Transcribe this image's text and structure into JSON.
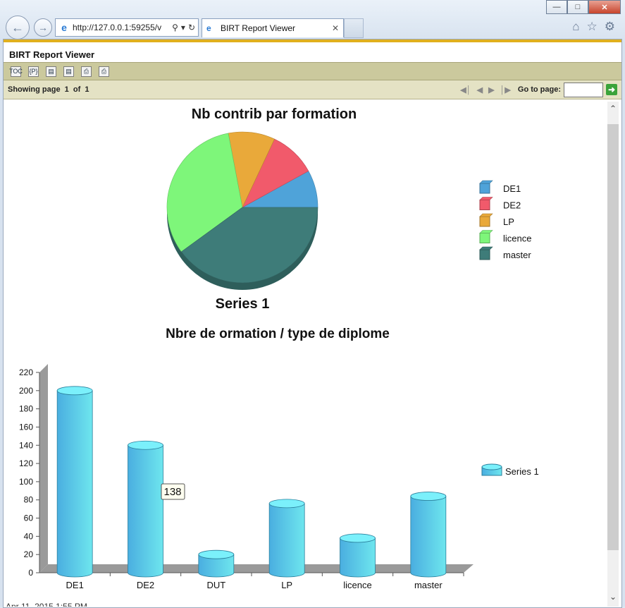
{
  "browser": {
    "address": "http://127.0.0.1:59255/v",
    "tab_title": "BIRT Report Viewer",
    "minimize": "—",
    "maximize": "□",
    "close": "✕",
    "back_icon": "back-arrow-icon",
    "forward_icon": "forward-arrow-icon",
    "tab_close": "✕"
  },
  "viewer": {
    "title": "BIRT Report Viewer",
    "toolbar_icons": [
      "toc-icon",
      "parameters-icon",
      "export-data-icon",
      "export-report-icon",
      "print-icon",
      "print-server-icon"
    ],
    "toolbar_labels": [
      "TOC",
      "{P}",
      "▤",
      "▤",
      "⎙",
      "⎙"
    ],
    "showing_page": "Showing page  1  of  1",
    "go_to_page": "Go to page:",
    "go_to_value": ""
  },
  "chart_data": [
    {
      "type": "pie",
      "title": "Nb contrib par formation",
      "series_label": "Series 1",
      "legend": "right",
      "slices": [
        {
          "label": "DE1",
          "value": 8,
          "color": "#4fa3d9"
        },
        {
          "label": "DE2",
          "value": 10,
          "color": "#f15a6b"
        },
        {
          "label": "LP",
          "value": 10,
          "color": "#e9a93a"
        },
        {
          "label": "licence",
          "value": 32,
          "color": "#7ef67a"
        },
        {
          "label": "master",
          "value": 40,
          "color": "#3e7c79"
        }
      ]
    },
    {
      "type": "bar",
      "title": "Nbre de ormation / type de diplome",
      "categories": [
        "DE1",
        "DE2",
        "DUT",
        "LP",
        "licence",
        "master"
      ],
      "series": [
        {
          "name": "Series 1",
          "values": [
            200,
            140,
            20,
            76,
            38,
            84
          ]
        }
      ],
      "ylim": [
        0,
        220
      ],
      "yticks": [
        0,
        20,
        40,
        60,
        80,
        100,
        120,
        140,
        160,
        180,
        200,
        220
      ],
      "tooltip": "138",
      "legend": "right"
    }
  ],
  "footer_partial": "Apr 11, 2015 1:55 PM"
}
